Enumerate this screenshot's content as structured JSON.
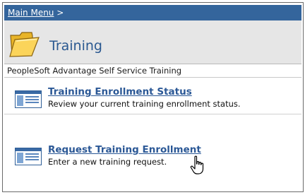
{
  "breadcrumb": {
    "link": "Main Menu",
    "separator": ">"
  },
  "page": {
    "title": "Training",
    "icon": "folder-icon"
  },
  "section": {
    "subtitle": "PeopleSoft Advantage Self Service Training"
  },
  "items": [
    {
      "label": "Training Enrollment Status",
      "description": "Review your current training enrollment status.",
      "icon": "page-icon"
    },
    {
      "label": "Request Training Enrollment",
      "description": "Enter a new training request.",
      "icon": "page-icon"
    }
  ],
  "colors": {
    "menu_bar": "#34659c",
    "link": "#2b5896",
    "title_bg": "#e6e6e6"
  },
  "cursor": {
    "icon": "hand-pointer-icon"
  }
}
